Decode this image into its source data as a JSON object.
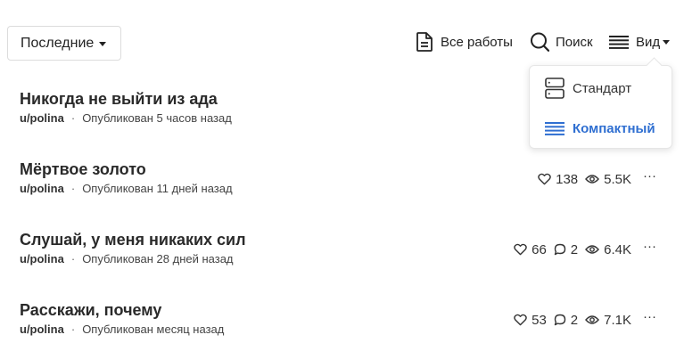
{
  "sort": {
    "label": "Последние"
  },
  "toolbar": {
    "all_works": "Все работы",
    "search": "Поиск",
    "view": "Вид"
  },
  "view_menu": {
    "standard": "Стандарт",
    "compact": "Компактный",
    "active": "compact",
    "active_color": "#2f6fd1"
  },
  "stories": [
    {
      "title": "Никогда не выйти из ада",
      "author": "u/polina",
      "published": "Опубликован 5 часов назад"
    },
    {
      "title": "Мёртвое золото",
      "author": "u/polina",
      "published": "Опубликован 11 дней назад",
      "likes": "138",
      "views": "5.5K"
    },
    {
      "title": "Слушай, у меня никаких сил",
      "author": "u/polina",
      "published": "Опубликован 28 дней назад",
      "likes": "66",
      "comments": "2",
      "views": "6.4K"
    },
    {
      "title": "Расскажи, почему",
      "author": "u/polina",
      "published": "Опубликован месяц назад",
      "likes": "53",
      "comments": "2",
      "views": "7.1K"
    }
  ],
  "separator": "·",
  "more_label": "···",
  "icons": {
    "all_works": "document-icon",
    "search": "search-icon",
    "view": "list-view-icon",
    "standard": "standard-view-icon",
    "compact": "compact-view-icon",
    "likes": "heart-icon",
    "comments": "comment-icon",
    "views": "eye-icon",
    "more": "more-options-icon"
  }
}
